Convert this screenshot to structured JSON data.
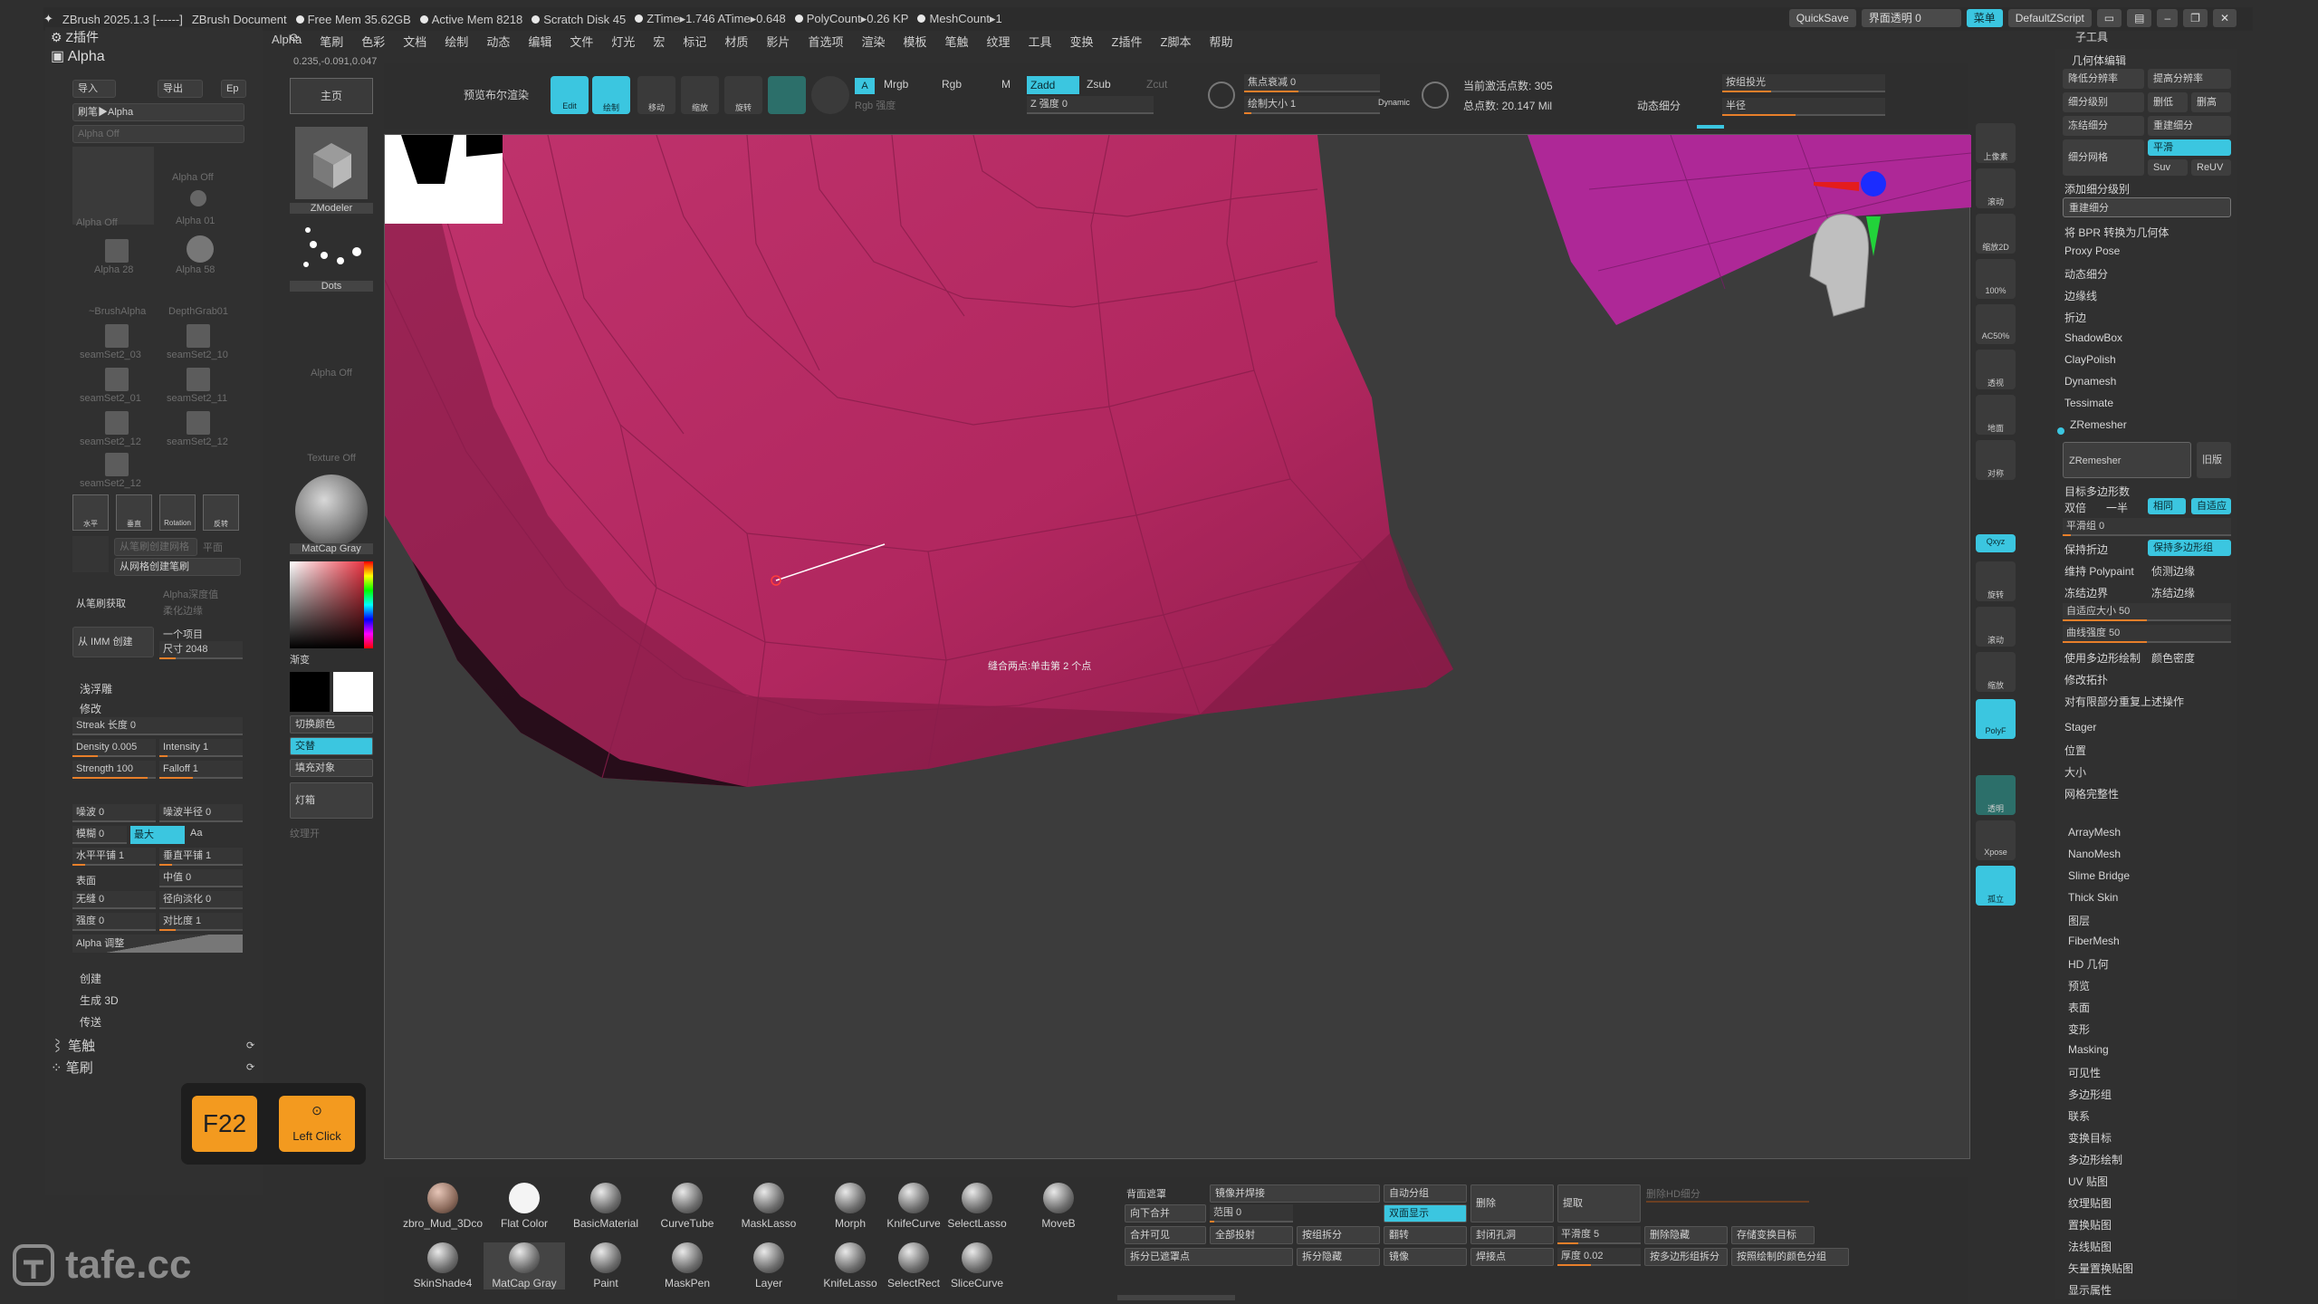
{
  "title_bar": {
    "app": "ZBrush 2025.1.3 [------]",
    "document": "ZBrush Document",
    "free_mem": "Free Mem 35.62GB",
    "active_mem": "Active Mem 8218",
    "scratch": "Scratch Disk 45",
    "ztime": "ZTime▸1.746 ATime▸0.648",
    "polycount": "PolyCount▸0.26 KP",
    "meshcount": "MeshCount▸1",
    "quicksave": "QuickSave",
    "transparency": "界面透明 0",
    "menu_btn": "菜单",
    "script": "DefaultZScript"
  },
  "menu": [
    "Alpha",
    "笔刷",
    "色彩",
    "文档",
    "绘制",
    "动态",
    "编辑",
    "文件",
    "灯光",
    "宏",
    "标记",
    "材质",
    "影片",
    "首选项",
    "渲染",
    "模板",
    "笔触",
    "纹理",
    "工具",
    "变换",
    "Z插件",
    "Z脚本",
    "帮助"
  ],
  "left": {
    "plugin_header": "Z插件",
    "alpha_header": "Alpha",
    "coords": "0.235,-0.091,0.047",
    "import": "导入",
    "export": "导出",
    "ep": "Ep",
    "brush_alpha": "刷笔▶Alpha",
    "alpha_off_bar": "Alpha Off",
    "alpha_off": "Alpha Off",
    "alpha01": "Alpha 01",
    "alpha28": "Alpha 28",
    "alpha58": "Alpha 58",
    "brush_alpha2": "~BrushAlpha",
    "depth": "DepthGrab01",
    "seams": [
      "seamSet2_03",
      "seamSet2_10",
      "seamSet2_01",
      "seamSet2_11",
      "seamSet2_12",
      "seamSet2_12",
      "seamSet2_12"
    ],
    "icons": [
      "水平",
      "垂直",
      "Rotation",
      "反转"
    ],
    "from_brush_mesh": "从笔刷创建网格",
    "flat": "平面",
    "from_mesh_brush": "从网格创建笔刷",
    "from_brush_get": "从笔刷获取",
    "alpha_depth": "Alpha深度值",
    "convert": "柔化边缘",
    "from_imm": "从 IMM 创建",
    "one_item": "一个项目",
    "size": "尺寸 2048",
    "emboss": "浅浮雕",
    "modify": "修改",
    "streak": "Streak 长度 0",
    "density": "Density 0.005",
    "intensity": "Intensity 1",
    "strength": "Strength 100",
    "falloff": "Falloff 1",
    "noise": "噪波 0",
    "noise_radius": "噪波半径 0",
    "blur": "模糊 0",
    "max": "最大",
    "aa": "Aa",
    "hsmooth": "水平平铺 1",
    "vsmooth": "垂直平铺 1",
    "surface": "表面",
    "mid": "中值 0",
    "seamless": "无缝 0",
    "radial": "径向淡化 0",
    "strength2": "强度 0",
    "contrast": "对比度 1",
    "alpha_adjust": "Alpha 调整",
    "create": "创建",
    "gen3d": "生成 3D",
    "transfer": "传送",
    "stroke": "笔触",
    "brush": "笔刷"
  },
  "doc_col": {
    "main": "主页",
    "zmodeler": "ZModeler",
    "dots": "Dots",
    "alpha_off": "Alpha Off",
    "texture_off": "Texture Off",
    "matcap": "MatCap Gray",
    "gradient": "渐变",
    "switch_color": "切换颜色",
    "alternate": "交替",
    "fill": "填充对象",
    "light": "灯箱",
    "texture_on": "纹理开"
  },
  "top_tools": {
    "bpr": "预览布尔渲染",
    "edit": "Edit",
    "draw": "绘制",
    "move": "移动",
    "scale": "缩放",
    "rotate": "旋转",
    "a": "A",
    "mrgb": "Mrgb",
    "rgb": "Rgb",
    "m": "M",
    "zadd": "Zadd",
    "zsub": "Zsub",
    "zcut": "Zcut",
    "rgb_strength": "Rgb 强度",
    "z_strength": "Z 强度 0",
    "focal": "焦点衰减 0",
    "draw_size": "绘制大小 1",
    "dynamic": "Dynamic",
    "active_points": "当前激活点数: 305",
    "total_points": "总点数: 20.147 Mil",
    "dyn_subdiv": "动态细分",
    "spot_light": "按组投光",
    "radius": "半径"
  },
  "canvas": {
    "hint": "缝合两点:单击第 2 个点"
  },
  "right_tools": [
    "上像素",
    "滚动",
    "缩放2D",
    "100%",
    "AC50%",
    "透视",
    "地面",
    "对称",
    "Qxyz",
    "旋转",
    "滚动",
    "缩放",
    "PolyF",
    "透明",
    "Xpose",
    "孤立"
  ],
  "right_panel": {
    "sub_tool": "子工具",
    "geometry": "几何体编辑",
    "lower_res": "降低分辨率",
    "higher_res": "提高分辨率",
    "subdiv_level": "细分级别",
    "del_lower": "删低",
    "del_higher": "删高",
    "freeze": "冻结细分",
    "reconstruct": "重建细分",
    "subdiv_mesh": "细分网格",
    "smooth": "平滑",
    "suv": "Suv",
    "reuv": "ReUV",
    "add_subdiv": "添加细分级别",
    "rebuild": "重建细分",
    "convert_bpr": "将 BPR 转换为几何体",
    "items": [
      "Proxy Pose",
      "动态细分",
      "边缘线",
      "折边",
      "ShadowBox",
      "ClayPolish",
      "Dynamesh",
      "Tessimate",
      "ZRemesher"
    ],
    "zremesher_btn": "ZRemesher",
    "legacy": "旧版",
    "target_poly": "目标多边形数",
    "double": "双倍",
    "half": "一半",
    "same": "相同",
    "adaptive": "自适应",
    "smooth_group": "平滑组 0",
    "keep_crease": "保持折边",
    "keep_polygroup": "保持多边形组",
    "keep_polypaint": "维持 Polypaint",
    "detect_edges": "侦测边缘",
    "freeze_border": "冻结边界",
    "freeze_edges": "冻结边缘",
    "adapt_size": "自适应大小 50",
    "curve_strength": "曲线强度 50",
    "use_poly_paint": "使用多边形绘制",
    "color_density": "颜色密度",
    "modify_topo": "修改拓扑",
    "repeat_op": "对有限部分重复上述操作",
    "stager": "Stager",
    "position": "位置",
    "size": "大小",
    "mesh_integrity": "网格完整性",
    "lower_list": [
      "ArrayMesh",
      "NanoMesh",
      "Slime Bridge",
      "Thick Skin",
      "图层",
      "FiberMesh",
      "HD 几何",
      "预览",
      "表面",
      "变形",
      "Masking",
      "可见性",
      "多边形组",
      "联系",
      "变换目标",
      "多边形绘制",
      "UV 贴图",
      "纹理贴图",
      "置换贴图",
      "法线贴图",
      "矢量置换贴图",
      "显示属性"
    ]
  },
  "bottom": {
    "materials": [
      "zbro_Mud_3Dco",
      "Flat Color",
      "BasicMaterial",
      "CurveTube",
      "MaskLasso",
      "Morph",
      "KnifeCurve",
      "SelectLasso",
      "MoveB",
      "SkinShade4",
      "MatCap Gray",
      "Paint",
      "MaskPen",
      "Layer",
      "KnifeLasso",
      "SelectRect",
      "SliceCurve"
    ],
    "backface": "背面遮罩",
    "mirror_weld": "镜像并焊接",
    "auto_group": "自动分组",
    "delete": "删除",
    "extract": "提取",
    "del_hidden_hd": "删除HD细分",
    "range": "范围 0",
    "double_display": "双面显示",
    "merge_visible": "合并可见",
    "all_proj": "全部投射",
    "group_split": "按组拆分",
    "flip": "翻转",
    "close_holes": "封闭孔洞",
    "smooth5": "平滑度 5",
    "del_hidden": "删除隐藏",
    "store_morph": "存储变换目标",
    "split_unmasked": "拆分已遮罩点",
    "split_hidden": "拆分隐藏",
    "mirror": "镜像",
    "weld_points": "焊接点",
    "thickness": "厚度 0.02",
    "group_by_poly": "按多边形组拆分",
    "group_by_paint": "按照绘制的颜色分组",
    "pos_move": "向下合并"
  },
  "keys": {
    "f22": "F22",
    "left_click": "Left Click"
  },
  "watermark": "tafe.cc",
  "colors": {
    "accent": "#3bc6e0",
    "mesh": "#b4275f",
    "slider": "#e87f2a",
    "key_orange": "#f39a1f"
  }
}
